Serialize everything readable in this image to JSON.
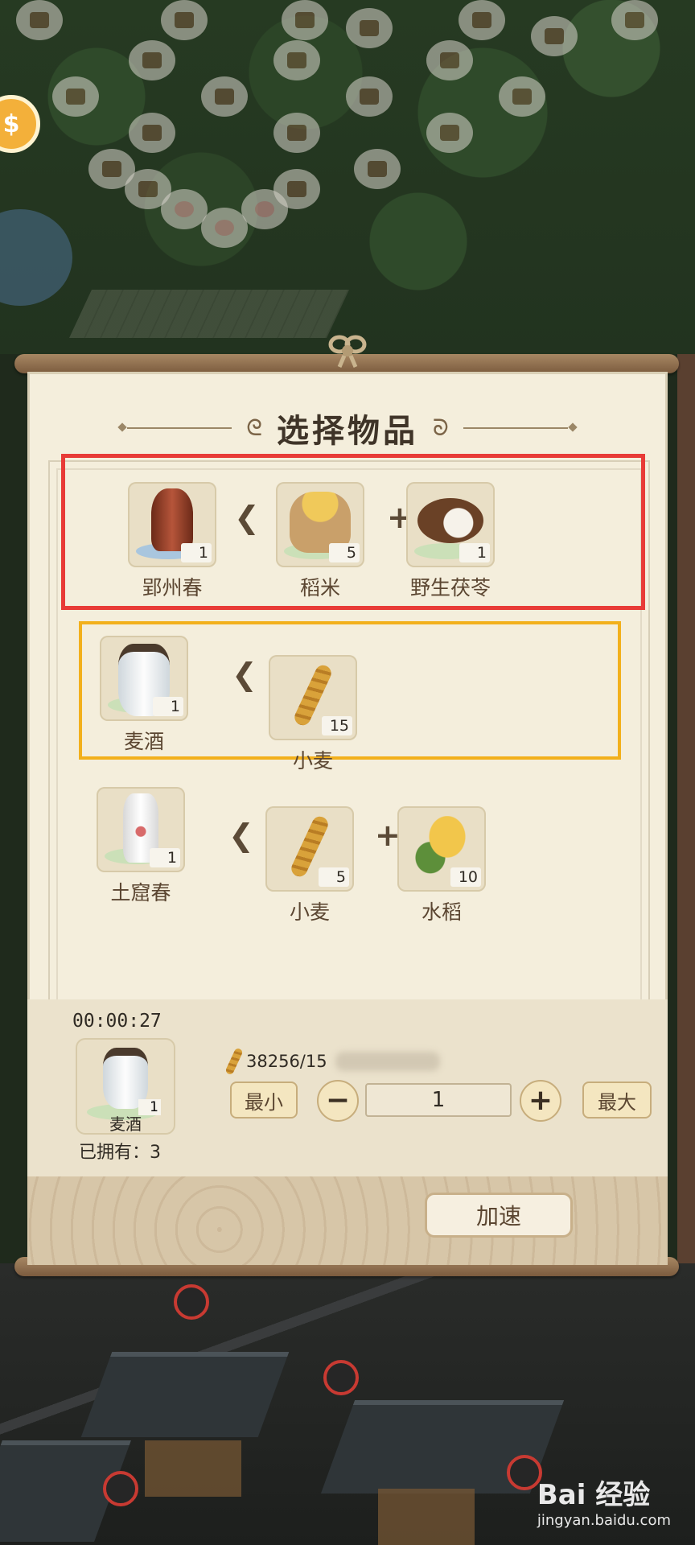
{
  "title": "选择物品",
  "recipes": [
    {
      "product": {
        "name": "郢州春",
        "count": "1",
        "icon": "dark-wine-jar-icon"
      },
      "ingredients": [
        {
          "name": "稻米",
          "count": "5",
          "icon": "rice-sack-icon"
        },
        {
          "name": "野生茯苓",
          "count": "1",
          "icon": "poria-root-icon"
        }
      ]
    },
    {
      "product": {
        "name": "麦酒",
        "count": "1",
        "icon": "white-wine-jug-icon"
      },
      "ingredients": [
        {
          "name": "小麦",
          "count": "15",
          "icon": "wheat-icon"
        }
      ]
    },
    {
      "product": {
        "name": "土窟春",
        "count": "1",
        "icon": "floral-wine-bottle-icon"
      },
      "ingredients": [
        {
          "name": "小麦",
          "count": "5",
          "icon": "wheat-icon"
        },
        {
          "name": "水稻",
          "count": "10",
          "icon": "rice-plant-icon"
        }
      ]
    }
  ],
  "production": {
    "timer": "00:00:27",
    "product_name": "麦酒",
    "product_count": "1",
    "owned": "已拥有：3",
    "resource_amount": "38256/15"
  },
  "controls": {
    "min_label": "最小",
    "max_label": "最大",
    "minus_label": "−",
    "plus_label": "+",
    "quantity": "1",
    "speed_label": "加速"
  },
  "background": {
    "watermark": "Bai 经验",
    "watermark_url": "jingyan.baidu.com"
  },
  "colors": {
    "selected_border": "#f2b01c",
    "highlight_border": "#e83b37",
    "panel_bg": "#f4eedc"
  }
}
